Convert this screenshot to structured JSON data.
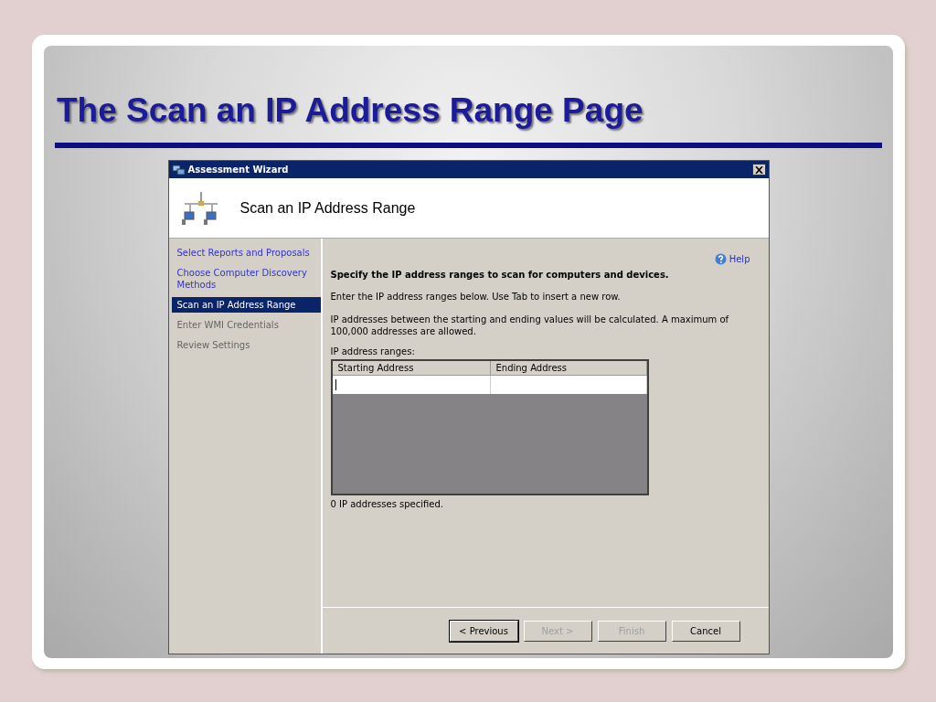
{
  "slide": {
    "title": "The Scan an IP Address Range Page"
  },
  "window": {
    "title": "Assessment Wizard",
    "header": "Scan an IP Address Range"
  },
  "sidebar": {
    "items": [
      {
        "label": "Select Reports and Proposals",
        "selected": false,
        "disabled": false
      },
      {
        "label": "Choose Computer Discovery Methods",
        "selected": false,
        "disabled": false
      },
      {
        "label": "Scan an IP Address Range",
        "selected": true,
        "disabled": false
      },
      {
        "label": "Enter WMI Credentials",
        "selected": false,
        "disabled": true
      },
      {
        "label": "Review Settings",
        "selected": false,
        "disabled": true
      }
    ]
  },
  "content": {
    "help": "Help",
    "heading": "Specify the IP address ranges to scan for computers and devices.",
    "paragraphs": [
      "Enter the IP address ranges below. Use Tab to insert a new row.",
      "IP addresses between the starting and ending values will be calculated. A maximum of 100,000 addresses are allowed."
    ],
    "table_label": "IP address ranges:",
    "table": {
      "columns": [
        "Starting Address",
        "Ending Address"
      ]
    },
    "status": "0 IP addresses specified."
  },
  "buttons": [
    {
      "label": "< Previous",
      "disabled": false,
      "default": true
    },
    {
      "label": "Next >",
      "disabled": true,
      "default": false
    },
    {
      "label": "Finish",
      "disabled": true,
      "default": false
    },
    {
      "label": "Cancel",
      "disabled": false,
      "default": false
    }
  ]
}
